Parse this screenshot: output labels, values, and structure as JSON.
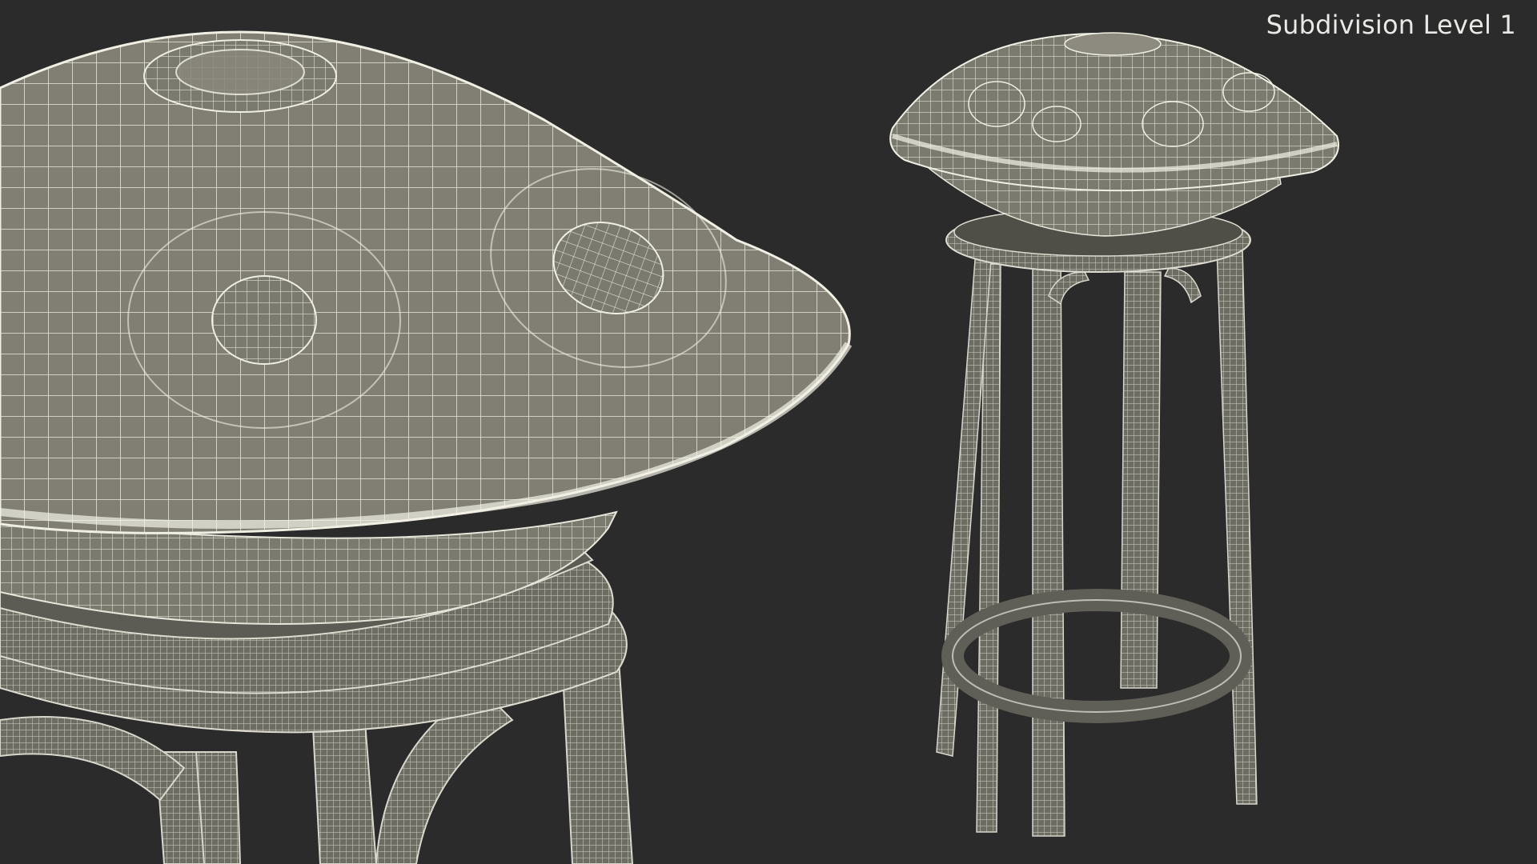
{
  "overlay": {
    "label": "Subdivision Level 1"
  },
  "scene": {
    "subject": "wireframe-render",
    "background_color": "#2a2b2a",
    "mesh_fill_color": "#7f7f73",
    "mesh_wire_color": "#ecebdf",
    "views": [
      {
        "name": "close-up-view"
      },
      {
        "name": "full-view"
      }
    ]
  }
}
